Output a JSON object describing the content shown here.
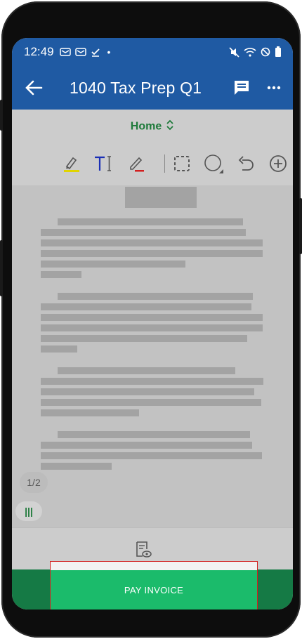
{
  "status_bar": {
    "time": "12:49",
    "left_icons": [
      "voicemail-icon",
      "voicemail-icon",
      "download-done-icon",
      "dot-icon"
    ],
    "right_icons": [
      "mute-icon",
      "wifi-icon",
      "do-not-disturb-icon",
      "battery-icon"
    ],
    "dot": "•"
  },
  "app_bar": {
    "title": "1040 Tax Prep Q1",
    "back_icon": "arrow-back-icon",
    "comment_icon": "comment-icon",
    "more_icon": "more-horizontal-icon"
  },
  "toolbar": {
    "mode_label": "Home",
    "tools": [
      "highlighter-icon",
      "text-box-icon",
      "pen-icon",
      "selection-icon",
      "shape-icon",
      "undo-icon",
      "add-icon"
    ]
  },
  "document": {
    "page_indicator": "1/2",
    "scroll_handle": "|||"
  },
  "bottom": {
    "preview_icon": "document-preview-icon",
    "pay_label": "PAY INVOICE"
  },
  "colors": {
    "app_bar": "#1f5aa3",
    "accent_green": "#1e7a3a",
    "pay_button": "#1bbb6b",
    "pay_bar": "#157a45",
    "highlight_frame": "#d21f1f"
  }
}
